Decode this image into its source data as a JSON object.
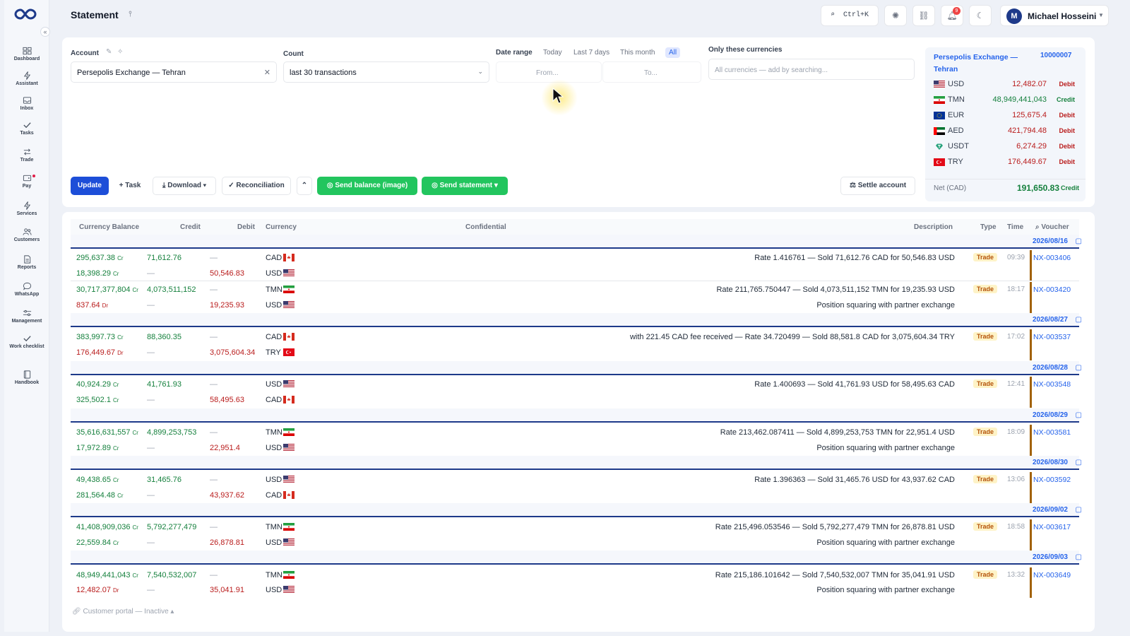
{
  "sidebar": {
    "items": [
      {
        "label": "Dashboard",
        "icon": "dashboard-icon"
      },
      {
        "label": "Assistant",
        "icon": "lightning-icon"
      },
      {
        "label": "Inbox",
        "icon": "inbox-icon"
      },
      {
        "label": "Tasks",
        "icon": "check-icon"
      },
      {
        "label": "Trade",
        "icon": "swap-icon"
      },
      {
        "label": "Pay",
        "icon": "wallet-icon"
      },
      {
        "label": "Services",
        "icon": "lightning-icon"
      },
      {
        "label": "Customers",
        "icon": "users-icon"
      },
      {
        "label": "Reports",
        "icon": "report-icon"
      },
      {
        "label": "WhatsApp",
        "icon": "chat-icon"
      },
      {
        "label": "Management",
        "icon": "sliders-icon"
      },
      {
        "label": "Work checklist",
        "icon": "check-icon"
      },
      {
        "label": "Handbook",
        "icon": "book-icon"
      }
    ]
  },
  "header": {
    "title": "Statement",
    "search_shortcut": "Ctrl+K",
    "notification_count": "9",
    "user_initial": "M",
    "user_name": "Michael Hosseini"
  },
  "filters": {
    "account_label": "Account",
    "account_value": "Persepolis Exchange — Tehran",
    "count_label": "Count",
    "count_value": "last 30 transactions",
    "date_range_label": "Date range",
    "date_chips": [
      "Today",
      "Last 7 days",
      "This month",
      "All"
    ],
    "date_active": "All",
    "from_placeholder": "From...",
    "to_placeholder": "To...",
    "currencies_label": "Only these currencies",
    "currencies_placeholder": "All currencies — add by searching..."
  },
  "actions": {
    "update": "Update",
    "task": "+ Task",
    "download": "Download ▾",
    "reconciliation": "✓ Reconciliation",
    "send_balance": "Send balance (image)",
    "send_statement": "Send statement ▾",
    "settle": "Settle account"
  },
  "balance_card": {
    "title": "Persepolis Exchange — Tehran",
    "account_number": "10000007",
    "rows": [
      {
        "currency": "USD",
        "amount": "12,482.07",
        "status": "Debit"
      },
      {
        "currency": "TMN",
        "amount": "48,949,441,043",
        "status": "Credit"
      },
      {
        "currency": "EUR",
        "amount": "125,675.4",
        "status": "Debit"
      },
      {
        "currency": "AED",
        "amount": "421,794.48",
        "status": "Debit"
      },
      {
        "currency": "USDT",
        "amount": "6,274.29",
        "status": "Debit"
      },
      {
        "currency": "TRY",
        "amount": "176,449.67",
        "status": "Debit"
      }
    ],
    "net_label": "Net (CAD)",
    "net_amount": "191,650.83",
    "net_status": "Credit"
  },
  "table": {
    "headers": {
      "balance": "Currency Balance",
      "credit": "Credit",
      "debit": "Debit",
      "currency": "Currency",
      "confidential": "Confidential",
      "description": "Description",
      "type": "Type",
      "time": "Time",
      "voucher": "Voucher"
    },
    "dates": [
      "2026/08/16",
      "2026/08/27",
      "2026/08/28",
      "2026/08/29",
      "2026/08/30",
      "2026/09/02",
      "2026/09/03"
    ],
    "rows": [
      {
        "balance": "295,637.38",
        "bs": "Cr",
        "credit": "71,612.76",
        "debit": "—",
        "currency": "CAD",
        "desc": "Rate 1.416761 — Sold 71,612.76 CAD for 50,546.83 USD",
        "type": "Trade",
        "time": "09:39",
        "voucher": "NX-003406"
      },
      {
        "balance": "18,398.29",
        "bs": "Cr",
        "credit": "—",
        "debit": "50,546.83",
        "currency": "USD",
        "desc": ""
      },
      {
        "balance": "30,717,377,804",
        "bs": "Cr",
        "credit": "4,073,511,152",
        "debit": "—",
        "currency": "TMN",
        "desc": "Rate 211,765.750447 — Sold 4,073,511,152 TMN for 19,235.93 USD",
        "type": "Trade",
        "time": "18:17",
        "voucher": "NX-003420"
      },
      {
        "balance": "837.64",
        "bs": "Dr",
        "credit": "—",
        "debit": "19,235.93",
        "currency": "USD",
        "desc": "Position squaring with partner exchange"
      },
      {
        "balance": "383,997.73",
        "bs": "Cr",
        "credit": "88,360.35",
        "debit": "—",
        "currency": "CAD",
        "desc": "with 221.45 CAD fee received — Rate 34.720499 — Sold 88,581.8 CAD for 3,075,604.34 TRY",
        "type": "Trade",
        "time": "17:02",
        "voucher": "NX-003537"
      },
      {
        "balance": "176,449.67",
        "bs": "Dr",
        "credit": "—",
        "debit": "3,075,604.34",
        "currency": "TRY",
        "desc": ""
      },
      {
        "balance": "40,924.29",
        "bs": "Cr",
        "credit": "41,761.93",
        "debit": "—",
        "currency": "USD",
        "desc": "Rate 1.400693 — Sold 41,761.93 USD for 58,495.63 CAD",
        "type": "Trade",
        "time": "12:41",
        "voucher": "NX-003548"
      },
      {
        "balance": "325,502.1",
        "bs": "Cr",
        "credit": "—",
        "debit": "58,495.63",
        "currency": "CAD",
        "desc": ""
      },
      {
        "balance": "35,616,631,557",
        "bs": "Cr",
        "credit": "4,899,253,753",
        "debit": "—",
        "currency": "TMN",
        "desc": "Rate 213,462.087411 — Sold 4,899,253,753 TMN for 22,951.4 USD",
        "type": "Trade",
        "time": "18:09",
        "voucher": "NX-003581"
      },
      {
        "balance": "17,972.89",
        "bs": "Cr",
        "credit": "—",
        "debit": "22,951.4",
        "currency": "USD",
        "desc": "Position squaring with partner exchange"
      },
      {
        "balance": "49,438.65",
        "bs": "Cr",
        "credit": "31,465.76",
        "debit": "—",
        "currency": "USD",
        "desc": "Rate 1.396363 — Sold 31,465.76 USD for 43,937.62 CAD",
        "type": "Trade",
        "time": "13:06",
        "voucher": "NX-003592"
      },
      {
        "balance": "281,564.48",
        "bs": "Cr",
        "credit": "—",
        "debit": "43,937.62",
        "currency": "CAD",
        "desc": ""
      },
      {
        "balance": "41,408,909,036",
        "bs": "Cr",
        "credit": "5,792,277,479",
        "debit": "—",
        "currency": "TMN",
        "desc": "Rate 215,496.053546 — Sold 5,792,277,479 TMN for 26,878.81 USD",
        "type": "Trade",
        "time": "18:58",
        "voucher": "NX-003617"
      },
      {
        "balance": "22,559.84",
        "bs": "Cr",
        "credit": "—",
        "debit": "26,878.81",
        "currency": "USD",
        "desc": "Position squaring with partner exchange"
      },
      {
        "balance": "48,949,441,043",
        "bs": "Cr",
        "credit": "7,540,532,007",
        "debit": "—",
        "currency": "TMN",
        "desc": "Rate 215,186.101642 — Sold 7,540,532,007 TMN for 35,041.91 USD",
        "type": "Trade",
        "time": "13:32",
        "voucher": "NX-003649"
      },
      {
        "balance": "12,482.07",
        "bs": "Dr",
        "credit": "—",
        "debit": "35,041.91",
        "currency": "USD",
        "desc": "Position squaring with partner exchange"
      }
    ]
  },
  "footer": {
    "portal": "Customer portal — Inactive"
  }
}
